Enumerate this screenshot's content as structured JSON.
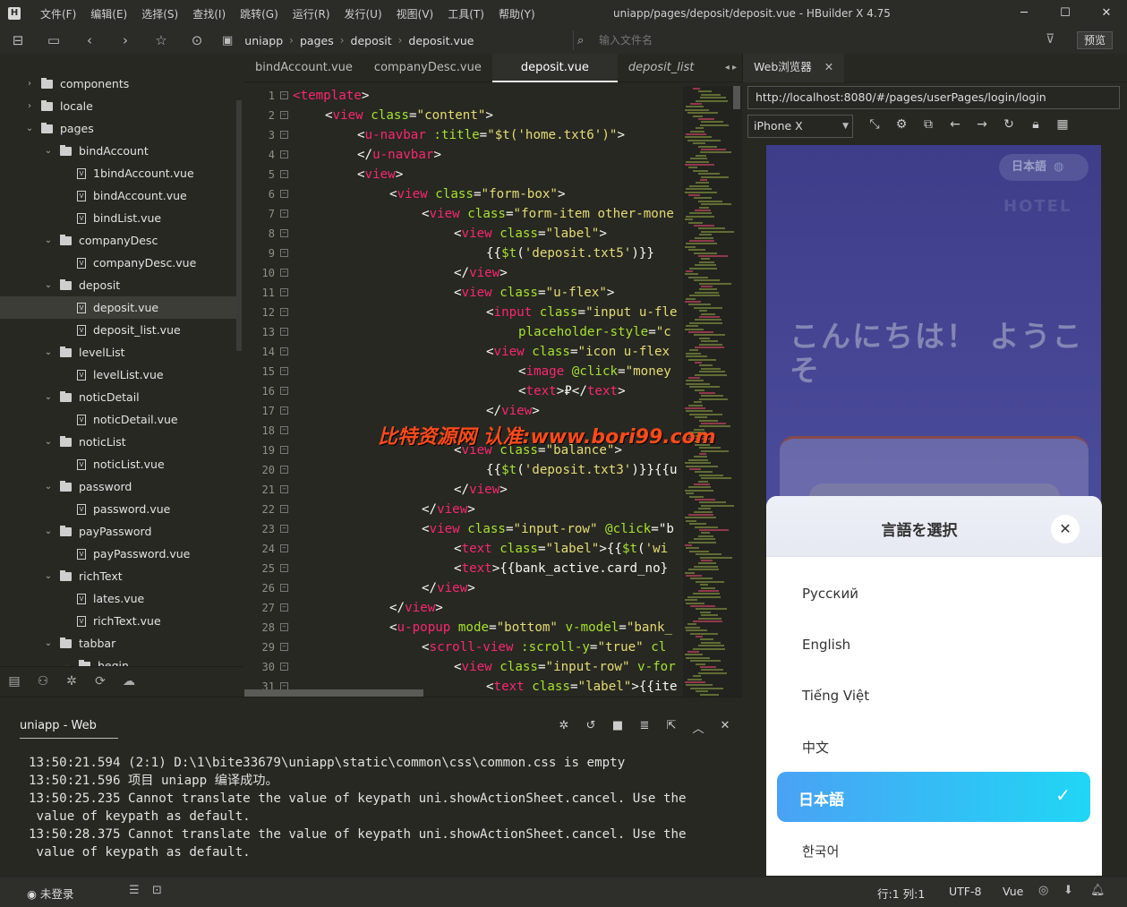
{
  "window": {
    "title": "uniapp/pages/deposit/deposit.vue - HBuilder X 4.75",
    "menu": [
      "文件(F)",
      "编辑(E)",
      "选择(S)",
      "查找(I)",
      "跳转(G)",
      "运行(R)",
      "发行(U)",
      "视图(V)",
      "工具(T)",
      "帮助(Y)"
    ],
    "controls": [
      "─",
      "☐",
      "✕"
    ]
  },
  "toolbar": {
    "breadcrumb": [
      "uniapp",
      "pages",
      "deposit",
      "deposit.vue"
    ],
    "file_search_placeholder": "输入文件名",
    "preview_label": "预览"
  },
  "sidebar": {
    "tree": [
      {
        "type": "folder",
        "label": "components",
        "expanded": false,
        "depth": 0
      },
      {
        "type": "folder",
        "label": "locale",
        "expanded": false,
        "depth": 0
      },
      {
        "type": "folder",
        "label": "pages",
        "expanded": true,
        "depth": 0
      },
      {
        "type": "folder",
        "label": "bindAccount",
        "expanded": true,
        "depth": 1
      },
      {
        "type": "file",
        "label": "1bindAccount.vue",
        "depth": 2
      },
      {
        "type": "file",
        "label": "bindAccount.vue",
        "depth": 2
      },
      {
        "type": "file",
        "label": "bindList.vue",
        "depth": 2
      },
      {
        "type": "folder",
        "label": "companyDesc",
        "expanded": true,
        "depth": 1
      },
      {
        "type": "file",
        "label": "companyDesc.vue",
        "depth": 2
      },
      {
        "type": "folder",
        "label": "deposit",
        "expanded": true,
        "depth": 1
      },
      {
        "type": "file",
        "label": "deposit.vue",
        "depth": 2,
        "selected": true
      },
      {
        "type": "file",
        "label": "deposit_list.vue",
        "depth": 2
      },
      {
        "type": "folder",
        "label": "levelList",
        "expanded": true,
        "depth": 1
      },
      {
        "type": "file",
        "label": "levelList.vue",
        "depth": 2
      },
      {
        "type": "folder",
        "label": "noticDetail",
        "expanded": true,
        "depth": 1
      },
      {
        "type": "file",
        "label": "noticDetail.vue",
        "depth": 2
      },
      {
        "type": "folder",
        "label": "noticList",
        "expanded": true,
        "depth": 1
      },
      {
        "type": "file",
        "label": "noticList.vue",
        "depth": 2
      },
      {
        "type": "folder",
        "label": "password",
        "expanded": true,
        "depth": 1
      },
      {
        "type": "file",
        "label": "password.vue",
        "depth": 2
      },
      {
        "type": "folder",
        "label": "payPassword",
        "expanded": true,
        "depth": 1
      },
      {
        "type": "file",
        "label": "payPassword.vue",
        "depth": 2
      },
      {
        "type": "folder",
        "label": "richText",
        "expanded": true,
        "depth": 1
      },
      {
        "type": "file",
        "label": "lates.vue",
        "depth": 2
      },
      {
        "type": "file",
        "label": "richText.vue",
        "depth": 2
      },
      {
        "type": "folder",
        "label": "tabbar",
        "expanded": true,
        "depth": 1
      },
      {
        "type": "folder",
        "label": "begin",
        "expanded": true,
        "depth": 2
      }
    ]
  },
  "editor": {
    "tabs": [
      {
        "label": "bindAccount.vue",
        "active": false
      },
      {
        "label": "companyDesc.vue",
        "active": false
      },
      {
        "label": "deposit.vue",
        "active": true
      },
      {
        "label": "deposit_list",
        "active": false,
        "italic": true
      }
    ],
    "lines": [
      {
        "n": "1",
        "indent": 0,
        "tokens": [
          [
            "t",
            "<template"
          ],
          [
            "p",
            ">"
          ]
        ]
      },
      {
        "n": "2",
        "indent": 1,
        "tokens": [
          [
            "p",
            "<"
          ],
          [
            "t",
            "view "
          ],
          [
            "a",
            "class"
          ],
          [
            "p",
            "="
          ],
          [
            "s",
            "\"content\""
          ],
          [
            "p",
            ">"
          ]
        ]
      },
      {
        "n": "3",
        "indent": 2,
        "tokens": [
          [
            "p",
            "<"
          ],
          [
            "t",
            "u-navbar "
          ],
          [
            "a",
            ":title"
          ],
          [
            "p",
            "="
          ],
          [
            "s",
            "\"$t('home.txt6')\""
          ],
          [
            "p",
            ">"
          ]
        ]
      },
      {
        "n": "4",
        "indent": 2,
        "tokens": [
          [
            "p",
            "</"
          ],
          [
            "t",
            "u-navbar"
          ],
          [
            "p",
            ">"
          ]
        ]
      },
      {
        "n": "5",
        "indent": 2,
        "tokens": [
          [
            "p",
            "<"
          ],
          [
            "t",
            "view"
          ],
          [
            "p",
            ">"
          ]
        ]
      },
      {
        "n": "6",
        "indent": 3,
        "tokens": [
          [
            "p",
            "<"
          ],
          [
            "t",
            "view "
          ],
          [
            "a",
            "class"
          ],
          [
            "p",
            "="
          ],
          [
            "s",
            "\"form-box\""
          ],
          [
            "p",
            ">"
          ]
        ]
      },
      {
        "n": "7",
        "indent": 4,
        "tokens": [
          [
            "p",
            "<"
          ],
          [
            "t",
            "view "
          ],
          [
            "a",
            "class"
          ],
          [
            "p",
            "="
          ],
          [
            "s",
            "\"form-item other-mone"
          ]
        ]
      },
      {
        "n": "8",
        "indent": 5,
        "tokens": [
          [
            "p",
            "<"
          ],
          [
            "t",
            "view "
          ],
          [
            "a",
            "class"
          ],
          [
            "p",
            "="
          ],
          [
            "s",
            "\"label\""
          ],
          [
            "p",
            ">"
          ]
        ]
      },
      {
        "n": "9",
        "indent": 6,
        "tokens": [
          [
            "p",
            "{{"
          ],
          [
            "a",
            "$t"
          ],
          [
            "p",
            "("
          ],
          [
            "s",
            "'deposit.txt5'"
          ],
          [
            "p",
            ")}}"
          ]
        ]
      },
      {
        "n": "10",
        "indent": 5,
        "tokens": [
          [
            "p",
            "</"
          ],
          [
            "t",
            "view"
          ],
          [
            "p",
            ">"
          ]
        ]
      },
      {
        "n": "11",
        "indent": 5,
        "tokens": [
          [
            "p",
            "<"
          ],
          [
            "t",
            "view "
          ],
          [
            "a",
            "class"
          ],
          [
            "p",
            "="
          ],
          [
            "s",
            "\"u-flex\""
          ],
          [
            "p",
            ">"
          ]
        ]
      },
      {
        "n": "12",
        "indent": 6,
        "tokens": [
          [
            "p",
            "<"
          ],
          [
            "t",
            "input "
          ],
          [
            "a",
            "class"
          ],
          [
            "p",
            "="
          ],
          [
            "s",
            "\"input u-fle"
          ]
        ]
      },
      {
        "n": "13",
        "indent": 7,
        "tokens": [
          [
            "a",
            "placeholder-style"
          ],
          [
            "p",
            "="
          ],
          [
            "s",
            "\"c"
          ]
        ]
      },
      {
        "n": "14",
        "indent": 6,
        "tokens": [
          [
            "p",
            "<"
          ],
          [
            "t",
            "view "
          ],
          [
            "a",
            "class"
          ],
          [
            "p",
            "="
          ],
          [
            "s",
            "\"icon u-flex"
          ]
        ]
      },
      {
        "n": "15",
        "indent": 7,
        "tokens": [
          [
            "p",
            "<"
          ],
          [
            "t",
            "image "
          ],
          [
            "a",
            "@click"
          ],
          [
            "p",
            "="
          ],
          [
            "s",
            "\"money"
          ]
        ]
      },
      {
        "n": "16",
        "indent": 7,
        "tokens": [
          [
            "p",
            "<"
          ],
          [
            "t",
            "text"
          ],
          [
            "p",
            ">₽</"
          ],
          [
            "t",
            "text"
          ],
          [
            "p",
            ">"
          ]
        ]
      },
      {
        "n": "17",
        "indent": 6,
        "tokens": [
          [
            "p",
            "</"
          ],
          [
            "t",
            "view"
          ],
          [
            "p",
            ">"
          ]
        ]
      },
      {
        "n": "18",
        "indent": 5,
        "tokens": []
      },
      {
        "n": "19",
        "indent": 5,
        "tokens": [
          [
            "p",
            "<"
          ],
          [
            "t",
            "view "
          ],
          [
            "a",
            "class"
          ],
          [
            "p",
            "="
          ],
          [
            "s",
            "\"balance\""
          ],
          [
            "p",
            ">"
          ]
        ]
      },
      {
        "n": "20",
        "indent": 6,
        "tokens": [
          [
            "p",
            "{{"
          ],
          [
            "a",
            "$t"
          ],
          [
            "p",
            "("
          ],
          [
            "s",
            "'deposit.txt3'"
          ],
          [
            "p",
            ")}}{{u"
          ]
        ]
      },
      {
        "n": "21",
        "indent": 5,
        "tokens": [
          [
            "p",
            "</"
          ],
          [
            "t",
            "view"
          ],
          [
            "p",
            ">"
          ]
        ]
      },
      {
        "n": "22",
        "indent": 4,
        "tokens": [
          [
            "p",
            "</"
          ],
          [
            "t",
            "view"
          ],
          [
            "p",
            ">"
          ]
        ]
      },
      {
        "n": "23",
        "indent": 4,
        "tokens": [
          [
            "p",
            "<"
          ],
          [
            "t",
            "view "
          ],
          [
            "a",
            "class"
          ],
          [
            "p",
            "="
          ],
          [
            "s",
            "\"input-row\" "
          ],
          [
            "a",
            "@click"
          ],
          [
            "p",
            "=\"b"
          ]
        ]
      },
      {
        "n": "24",
        "indent": 5,
        "tokens": [
          [
            "p",
            "<"
          ],
          [
            "t",
            "text "
          ],
          [
            "a",
            "class"
          ],
          [
            "p",
            "="
          ],
          [
            "s",
            "\"label\""
          ],
          [
            "p",
            ">{{"
          ],
          [
            "a",
            "$t"
          ],
          [
            "p",
            "("
          ],
          [
            "s",
            "'wi"
          ]
        ]
      },
      {
        "n": "25",
        "indent": 5,
        "tokens": [
          [
            "p",
            "<"
          ],
          [
            "t",
            "text"
          ],
          [
            "p",
            ">{{bank_active.card_no}"
          ]
        ]
      },
      {
        "n": "26",
        "indent": 4,
        "tokens": [
          [
            "p",
            "</"
          ],
          [
            "t",
            "view"
          ],
          [
            "p",
            ">"
          ]
        ]
      },
      {
        "n": "27",
        "indent": 3,
        "tokens": [
          [
            "p",
            "</"
          ],
          [
            "t",
            "view"
          ],
          [
            "p",
            ">"
          ]
        ]
      },
      {
        "n": "28",
        "indent": 3,
        "tokens": [
          [
            "p",
            "<"
          ],
          [
            "t",
            "u-popup "
          ],
          [
            "a",
            "mode"
          ],
          [
            "p",
            "="
          ],
          [
            "s",
            "\"bottom\" "
          ],
          [
            "a",
            "v-model"
          ],
          [
            "p",
            "="
          ],
          [
            "s",
            "\"bank_"
          ]
        ]
      },
      {
        "n": "29",
        "indent": 4,
        "tokens": [
          [
            "p",
            "<"
          ],
          [
            "t",
            "scroll-view "
          ],
          [
            "a",
            ":scroll-y"
          ],
          [
            "p",
            "="
          ],
          [
            "s",
            "\"true\" "
          ],
          [
            "a",
            "cl"
          ]
        ]
      },
      {
        "n": "30",
        "indent": 5,
        "tokens": [
          [
            "p",
            "<"
          ],
          [
            "t",
            "view "
          ],
          [
            "a",
            "class"
          ],
          [
            "p",
            "="
          ],
          [
            "s",
            "\"input-row\" "
          ],
          [
            "a",
            "v-for"
          ]
        ]
      },
      {
        "n": "31",
        "indent": 6,
        "tokens": [
          [
            "p",
            "<"
          ],
          [
            "t",
            "text "
          ],
          [
            "a",
            "class"
          ],
          [
            "p",
            "="
          ],
          [
            "s",
            "\"label\""
          ],
          [
            "p",
            ">{{ite"
          ]
        ]
      }
    ]
  },
  "browser": {
    "tab_label": "Web浏览器",
    "url": "http://localhost:8080/#/pages/userPages/login/login",
    "device": "iPhone X",
    "phone": {
      "lang_badge": "日本語",
      "hotel_text": "HOTEL",
      "welcome": "こんにちは！ ようこそ"
    },
    "sheet": {
      "title": "言語を選択",
      "options": [
        "Русский",
        "English",
        "Tiếng Việt",
        "中文",
        "日本語",
        "한국어"
      ],
      "selected": "日本語"
    }
  },
  "watermark": "比特资源网 认准:www.bori99.com",
  "console": {
    "tab_label": "uniapp - Web",
    "lines": [
      "13:50:21.594 (2:1) D:\\1\\bite33679\\uniapp\\static\\common\\css\\common.css is empty",
      "13:50:21.596 项目 uniapp 编译成功。",
      "13:50:25.235 Cannot translate the value of keypath uni.showActionSheet.cancel. Use the",
      " value of keypath as default.",
      "13:50:28.375 Cannot translate the value of keypath uni.showActionSheet.cancel. Use the",
      " value of keypath as default."
    ]
  },
  "statusbar": {
    "login": "未登录",
    "position": "行:1  列:1",
    "encoding": "UTF-8",
    "language": "Vue"
  }
}
